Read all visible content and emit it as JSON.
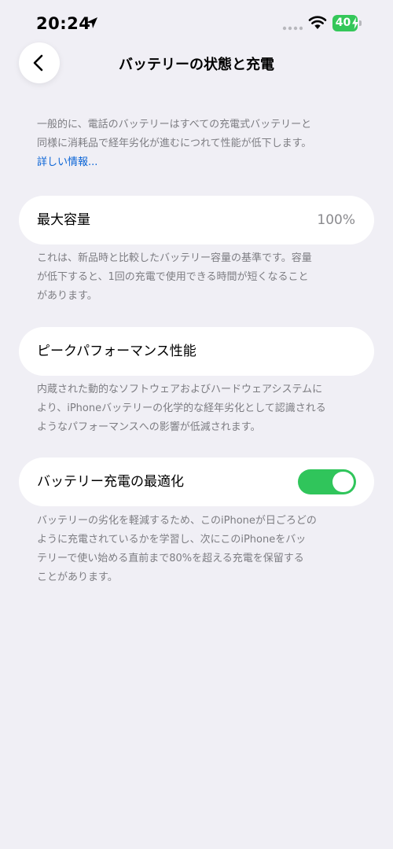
{
  "status_bar": {
    "time": "20:24",
    "battery_level": "40",
    "battery_color": "#34c759",
    "icons": [
      "location-arrow-icon",
      "signal-icon",
      "wifi-icon",
      "battery-icon",
      "charging-bolt-icon"
    ]
  },
  "nav": {
    "back_icon": "chevron-left-icon",
    "title": "バッテリーの状態と充電"
  },
  "intro": {
    "lines": [
      "一般的に、電話のバッテリーはすべての充電式バッテリーと",
      "同様に消耗品で経年劣化が進むにつれて性能が低下します。"
    ],
    "link": "詳しい情報..."
  },
  "max_capacity": {
    "label": "最大容量",
    "value": "100%",
    "description_lines": [
      "これは、新品時と比較したバッテリー容量の基準です。容量",
      "が低下すると、1回の充電で使用できる時間が短くなること",
      "があります。"
    ]
  },
  "peak_performance": {
    "label": "ピークパフォーマンス性能",
    "description_lines": [
      "内蔵された動的なソフトウェアおよびハードウェアシステムに",
      "より、iPhoneバッテリーの化学的な経年劣化として認識される",
      "ようなパフォーマンスへの影響が低減されます。"
    ]
  },
  "optimized_charging": {
    "label": "バッテリー充電の最適化",
    "toggle_on": true,
    "toggle_color": "#30c55b",
    "description_lines": [
      "バッテリーの劣化を軽減するため、このiPhoneが日ごろどの",
      "ように充電されているかを学習し、次にこのiPhoneをバッ",
      "テリーで使い始める直前まで80%を超える充電を保留する",
      "ことがあります。"
    ]
  }
}
